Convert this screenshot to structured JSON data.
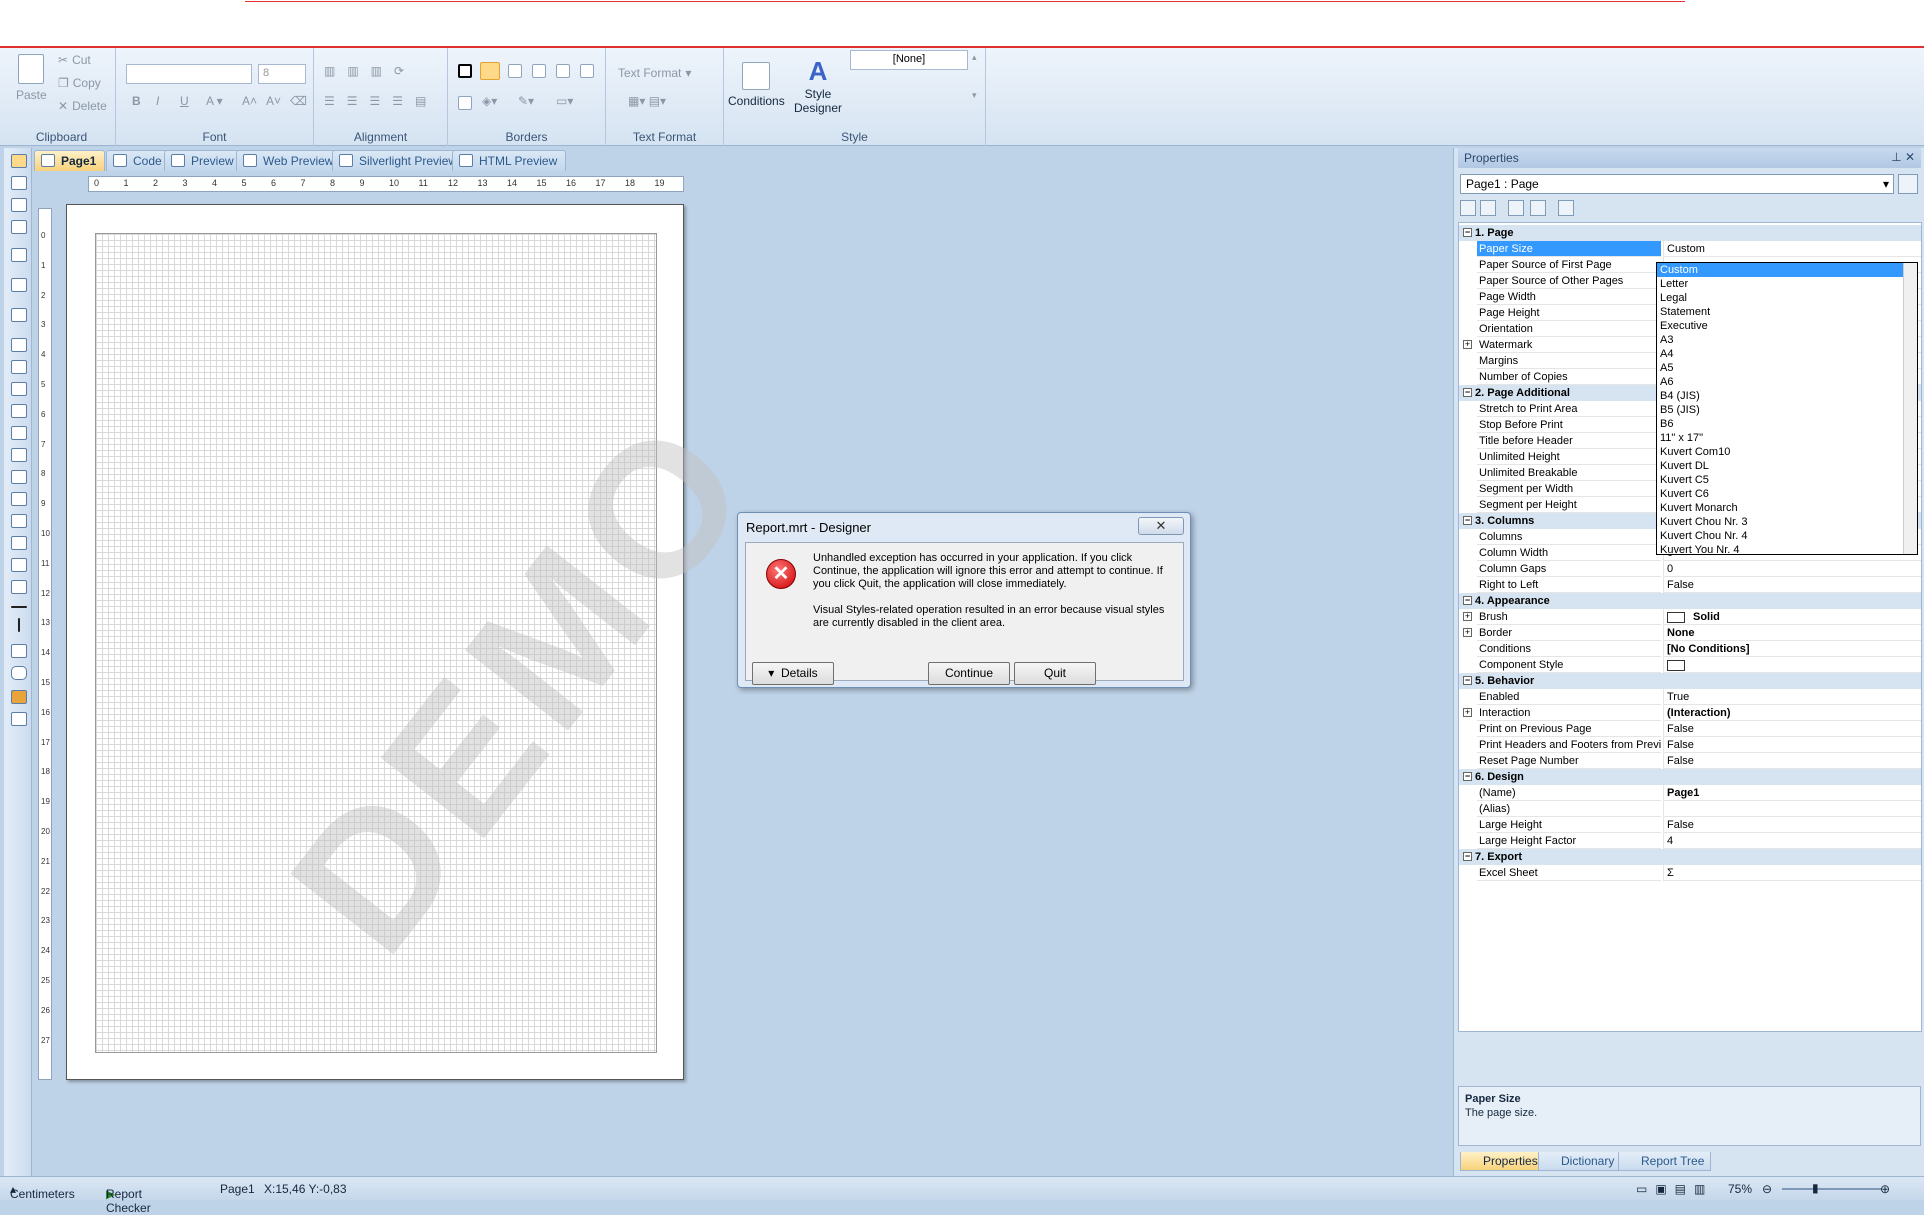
{
  "ribbon": {
    "clipboard": {
      "paste": "Paste",
      "cut": "Cut",
      "copy": "Copy",
      "delete": "Delete",
      "label": "Clipboard"
    },
    "font": {
      "size": "8",
      "label": "Font",
      "bold": "B",
      "italic": "I",
      "underline": "U"
    },
    "alignment": {
      "label": "Alignment"
    },
    "borders": {
      "label": "Borders"
    },
    "text_format": {
      "combo": "Text Format",
      "label": "Text Format"
    },
    "style": {
      "conditions": "Conditions",
      "style_designer_1": "Style",
      "style_designer_2": "Designer",
      "style_value": "[None]",
      "label": "Style"
    }
  },
  "tabs": [
    {
      "label": "Page1",
      "active": true
    },
    {
      "label": "Code"
    },
    {
      "label": "Preview"
    },
    {
      "label": "Web Preview"
    },
    {
      "label": "Silverlight Preview"
    },
    {
      "label": "HTML Preview"
    }
  ],
  "ruler": {
    "h": [
      "0",
      "1",
      "2",
      "3",
      "4",
      "5",
      "6",
      "7",
      "8",
      "9",
      "10",
      "11",
      "12",
      "13",
      "14",
      "15",
      "16",
      "17",
      "18",
      "19"
    ],
    "v": [
      "0",
      "1",
      "2",
      "3",
      "4",
      "5",
      "6",
      "7",
      "8",
      "9",
      "10",
      "11",
      "12",
      "13",
      "14",
      "15",
      "16",
      "17",
      "18",
      "19",
      "20",
      "21",
      "22",
      "23",
      "24",
      "25",
      "26",
      "27"
    ]
  },
  "canvas": {
    "watermark": "DEMO"
  },
  "dialog": {
    "title": "Report.mrt - Designer",
    "close": "✕",
    "message1": "Unhandled exception has occurred in your application. If you click Continue, the application will ignore this error and attempt to continue. If you click Quit, the application will close immediately.",
    "message2": "Visual Styles-related operation resulted in an error because visual styles are currently disabled in the client area.",
    "details": "Details",
    "continue": "Continue",
    "quit": "Quit"
  },
  "properties": {
    "title": "Properties",
    "object": "Page1 : Page",
    "rows": [
      {
        "type": "cat",
        "name": "1. Page"
      },
      {
        "name": "Paper Size",
        "value": "Custom",
        "selected": true
      },
      {
        "name": "Paper Source of First Page",
        "value": ""
      },
      {
        "name": "Paper Source of Other Pages",
        "value": ""
      },
      {
        "name": "Page Width",
        "value": ""
      },
      {
        "name": "Page Height",
        "value": ""
      },
      {
        "name": "Orientation",
        "value": ""
      },
      {
        "name": "Watermark",
        "value": "",
        "expand": true
      },
      {
        "name": "Margins",
        "value": ""
      },
      {
        "name": "Number of Copies",
        "value": ""
      },
      {
        "type": "cat",
        "name": "2. Page  Additional"
      },
      {
        "name": "Stretch to Print Area",
        "value": ""
      },
      {
        "name": "Stop Before Print",
        "value": ""
      },
      {
        "name": "Title before Header",
        "value": ""
      },
      {
        "name": "Unlimited Height",
        "value": ""
      },
      {
        "name": "Unlimited Breakable",
        "value": ""
      },
      {
        "name": "Segment per Width",
        "value": ""
      },
      {
        "name": "Segment per Height",
        "value": ""
      },
      {
        "type": "cat",
        "name": "3. Columns"
      },
      {
        "name": "Columns",
        "value": ""
      },
      {
        "name": "Column Width",
        "value": "0"
      },
      {
        "name": "Column Gaps",
        "value": "0"
      },
      {
        "name": "Right to Left",
        "value": "False"
      },
      {
        "type": "cat",
        "name": "4. Appearance"
      },
      {
        "name": "Brush",
        "value": "Solid",
        "expand": true,
        "swatch": true,
        "bold": true
      },
      {
        "name": "Border",
        "value": "None",
        "expand": true,
        "bold": true
      },
      {
        "name": "Conditions",
        "value": "[No Conditions]",
        "bold": true
      },
      {
        "name": "Component Style",
        "value": "",
        "swatch": true
      },
      {
        "type": "cat",
        "name": "5. Behavior"
      },
      {
        "name": "Enabled",
        "value": "True"
      },
      {
        "name": "Interaction",
        "value": "(Interaction)",
        "expand": true,
        "bold": true
      },
      {
        "name": "Print on Previous Page",
        "value": "False"
      },
      {
        "name": "Print Headers and Footers from Previ",
        "value": "False"
      },
      {
        "name": "Reset Page Number",
        "value": "False"
      },
      {
        "type": "cat",
        "name": "6. Design"
      },
      {
        "name": "(Name)",
        "value": "Page1",
        "bold": true
      },
      {
        "name": "(Alias)",
        "value": ""
      },
      {
        "name": "Large Height",
        "value": "False"
      },
      {
        "name": "Large Height Factor",
        "value": "4"
      },
      {
        "type": "cat",
        "name": "7. Export"
      },
      {
        "name": "Excel Sheet",
        "value": "Σ"
      }
    ],
    "paper_sizes": [
      "Custom",
      "Letter",
      "Legal",
      "Statement",
      "Executive",
      "A3",
      "A4",
      "A5",
      "A6",
      "B4 (JIS)",
      "B5 (JIS)",
      "B6",
      "11\" x 17\"",
      "Kuvert Com10",
      "Kuvert DL",
      "Kuvert C5",
      "Kuvert C6",
      "Kuvert Monarch",
      "Kuvert Chou Nr. 3",
      "Kuvert Chou Nr. 4",
      "Kuvert You Nr. 4"
    ],
    "description_title": "Paper Size",
    "description_text": "The page size.",
    "bottom_tabs": [
      "Properties",
      "Dictionary",
      "Report Tree"
    ]
  },
  "status": {
    "units": "Centimeters",
    "checker": "Report Checker",
    "page": "Page1",
    "coords": "X:15,46  Y:-0,83",
    "zoom": "75%"
  }
}
